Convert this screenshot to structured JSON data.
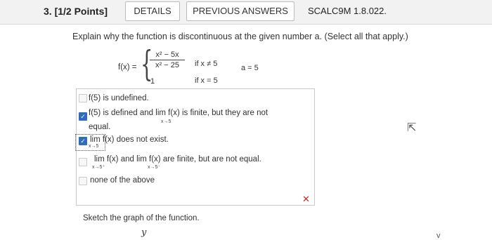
{
  "header": {
    "question_number": "3. [1/2 Points]",
    "details_label": "DETAILS",
    "previous_answers_label": "PREVIOUS ANSWERS",
    "code": "SCALC9M 1.8.022."
  },
  "question": {
    "prompt": "Explain why the function is discontinuous at the given number a. (Select all that apply.)",
    "f_label": "f(x) =",
    "numerator": "x² − 5x",
    "denominator": "x² − 25",
    "case2_value": "1",
    "case1_condition": "if x ≠ 5",
    "case2_condition": "if x = 5",
    "a_value": "a = 5"
  },
  "options": [
    {
      "text": "f(5) is undefined.",
      "checked": false
    },
    {
      "text1": "f(5) is defined and",
      "lim": "lim",
      "mid": "f(x) is finite, but they are not",
      "sub": "x→5",
      "text2": "equal.",
      "checked": true
    },
    {
      "lim": "lim",
      "text": "f(x) does not exist.",
      "sub": "x→5",
      "checked": true
    },
    {
      "lim1": "lim",
      "mid1": "f(x) and",
      "lim2": "lim",
      "mid2": "f(x) are finite, but are not equal.",
      "sub1": "x→5⁺",
      "sub2": "x→5⁻",
      "checked": false
    },
    {
      "text": "none of the above",
      "checked": false
    }
  ],
  "result_icon": "x-icon",
  "result_symbol": "✕",
  "sketch_prompt": "Sketch the graph of the function.",
  "y_axis_label": "y",
  "cursor_icon": "pointer-cursor",
  "cursor_glyph": "⇱",
  "corner_mark": "v",
  "colors": {
    "checked": "#2f6dbb",
    "wrong": "#cc2222"
  }
}
